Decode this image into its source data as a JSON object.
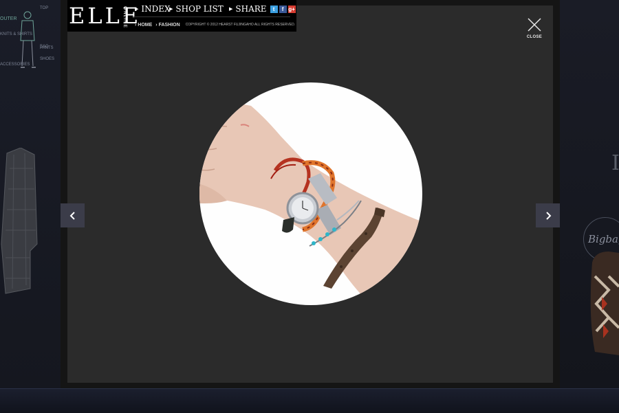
{
  "header": {
    "logo": "ELLE",
    "logo_sub": "ONLINE",
    "nav": {
      "index": "INDEX",
      "shop_list": "SHOP LIST",
      "share": "SHARE"
    },
    "share_icons": [
      "twitter-icon",
      "facebook-icon",
      "google-plus-icon"
    ],
    "breadcrumb": [
      "HOME",
      "FASHION"
    ],
    "copyright": "COPYRIGHT © 2012 HEARST FUJINGAHO ALL RIGHTS RESERVED."
  },
  "close": {
    "label": "CLOSE"
  },
  "navigation": {
    "prev_icon": "chevron-left-icon",
    "next_icon": "chevron-right-icon"
  },
  "background": {
    "menu": [
      "TOP",
      "OUTER",
      "KNITS & SHIRTS",
      "BAG",
      "SHOES",
      "PANTS",
      "ACCESSORIES"
    ],
    "bag_label": "Bigbag"
  },
  "colors": {
    "modal_panel": "#2b2b2b",
    "header_bg": "#000000",
    "arrow_bg": "#3b3c49",
    "twitter": "#3b9fe0",
    "facebook": "#3b5998",
    "google_plus": "#d73d32"
  }
}
